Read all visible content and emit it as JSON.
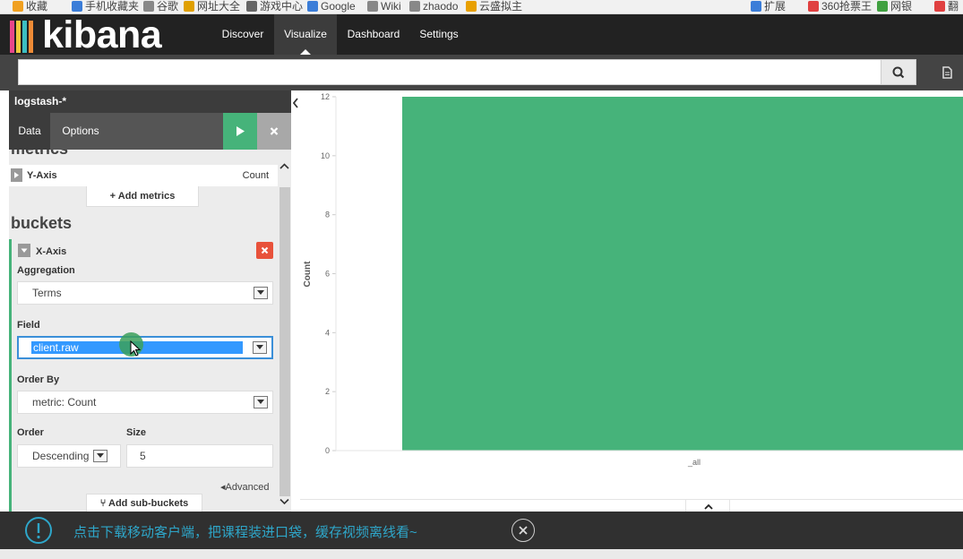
{
  "favorites": [
    {
      "label": "收藏",
      "icon": "star-icon",
      "color": "#f0a020"
    },
    {
      "label": "手机收藏夹",
      "icon": "phone-icon",
      "color": "#3b7dd8"
    },
    {
      "label": "谷歌",
      "icon": "page-icon",
      "color": "#888888"
    },
    {
      "label": "网址大全",
      "icon": "globe-icon",
      "color": "#e0a000"
    },
    {
      "label": "游戏中心",
      "icon": "gamepad-icon",
      "color": "#666666"
    },
    {
      "label": "Google",
      "icon": "google-icon",
      "color": "#3b7dd8"
    },
    {
      "label": "Wiki",
      "icon": "page-icon",
      "color": "#888888"
    },
    {
      "label": "zhaodo",
      "icon": "page-icon",
      "color": "#888888"
    },
    {
      "label": "云盛拟主",
      "icon": "cloud-icon",
      "color": "#e8a000"
    },
    {
      "label": "扩展",
      "icon": "grid-icon",
      "color": "#3b7dd8"
    },
    {
      "label": "360抢票王",
      "icon": "ticket-icon",
      "color": "#e04040"
    },
    {
      "label": "网银",
      "icon": "coin-icon",
      "color": "#40a040"
    },
    {
      "label": "翻",
      "icon": "translate-icon",
      "color": "#e04040"
    }
  ],
  "nav": {
    "brand": "kibana",
    "brand_colors": [
      "#e8478b",
      "#f0c93c",
      "#3cbec2",
      "#f08c36"
    ],
    "items": [
      "Discover",
      "Visualize",
      "Dashboard",
      "Settings"
    ],
    "active": "Visualize"
  },
  "search": {
    "value": "",
    "placeholder": ""
  },
  "sidebar": {
    "index_pattern": "logstash-*",
    "tabs": [
      "Data",
      "Options"
    ],
    "metrics_title": "metrics",
    "y_axis": {
      "label": "Y-Axis",
      "value": "Count"
    },
    "add_metrics": "Add metrics",
    "buckets_title": "buckets",
    "x_axis": {
      "label": "X-Axis"
    },
    "aggregation": {
      "label": "Aggregation",
      "value": "Terms"
    },
    "field": {
      "label": "Field",
      "value": "client.raw"
    },
    "order_by": {
      "label": "Order By",
      "value": "metric: Count"
    },
    "order": {
      "label": "Order",
      "value": "Descending"
    },
    "size": {
      "label": "Size",
      "value": "5"
    },
    "advanced": "Advanced",
    "add_sub_buckets": "Add sub-buckets"
  },
  "chart_data": {
    "type": "bar",
    "categories": [
      "_all"
    ],
    "values": [
      12
    ],
    "title": "",
    "xlabel": "",
    "ylabel": "Count",
    "ylim": [
      0,
      12
    ],
    "yticks": [
      0,
      2,
      4,
      6,
      8,
      10,
      12
    ],
    "bar_color": "#46b37a",
    "grid": false
  },
  "overlay": {
    "message": "点击下载移动客户端，把课程装进口袋，缓存视频离线看~",
    "accent": "#2ea6c9"
  }
}
